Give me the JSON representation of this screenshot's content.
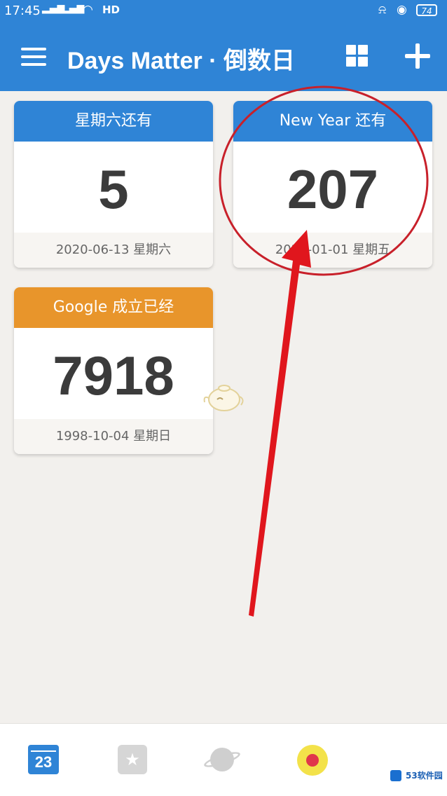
{
  "status_bar": {
    "time": "17:45",
    "signal1": "4G",
    "signal2": "4G",
    "hd": "HD",
    "battery": "74"
  },
  "app_bar": {
    "title": "Days Matter · 倒数日",
    "icons": [
      "menu-icon",
      "grid-view-icon",
      "add-icon"
    ]
  },
  "cards": [
    {
      "header": "星期六还有",
      "count": "5",
      "date": "2020-06-13 星期六",
      "color": "#2f84d6"
    },
    {
      "header": "New Year 还有",
      "count": "207",
      "date": "2021-01-01 星期五",
      "color": "#2f84d6"
    },
    {
      "header": "Google 成立已经",
      "count": "7918",
      "date": "1998-10-04 星期日",
      "color": "#e8952b"
    }
  ],
  "bottom_nav": {
    "calendar_day": "23",
    "items": [
      "calendar-icon",
      "star-card-icon",
      "planet-icon",
      "tomato-icon"
    ]
  },
  "watermark": "53软件园",
  "colors": {
    "primary": "#2f84d6",
    "accent_orange": "#e8952b",
    "annotation_red": "#d8232a"
  }
}
